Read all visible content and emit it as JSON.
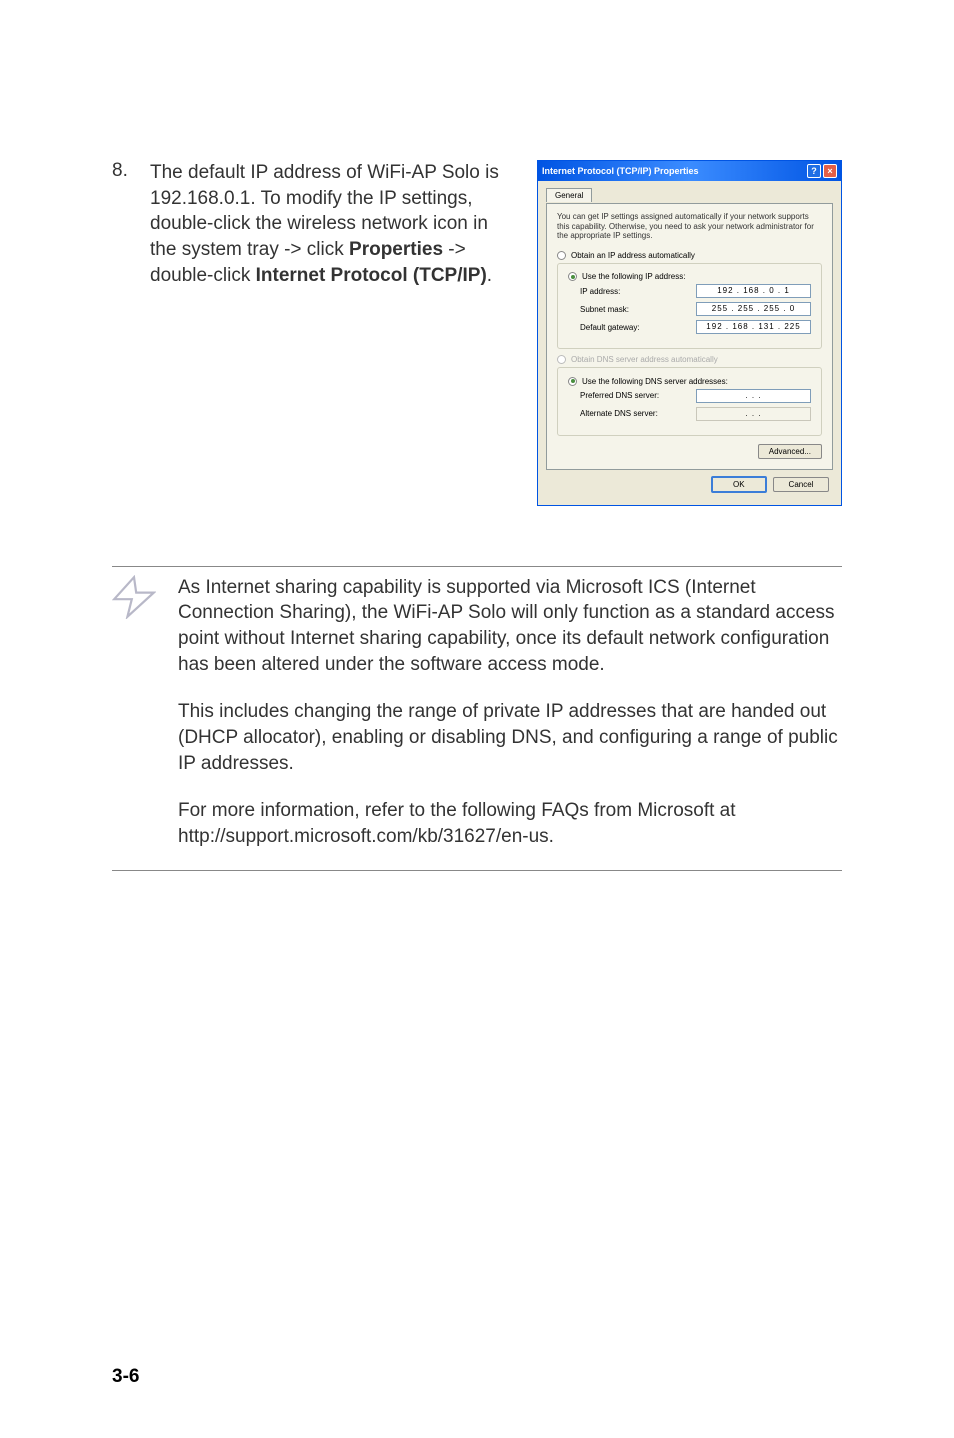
{
  "step": {
    "number": "8.",
    "text_parts": [
      "The default IP address of WiFi-AP Solo is 192.168.0.1. To modify the IP settings, double-click the wireless network icon in the system tray -> click ",
      "Properties",
      " -> double-click ",
      "Internet Protocol (TCP/IP)",
      "."
    ]
  },
  "dialog": {
    "title": "Internet Protocol (TCP/IP) Properties",
    "help_symbol": "?",
    "close_symbol": "×",
    "tab": "General",
    "info": "You can get IP settings assigned automatically if your network supports this capability. Otherwise, you need to ask your network administrator for the appropriate IP settings.",
    "radio_auto_ip": "Obtain an IP address automatically",
    "radio_use_ip": "Use the following IP address:",
    "ip_label": "IP address:",
    "ip_value": "192 . 168 .  0  .  1",
    "subnet_label": "Subnet mask:",
    "subnet_value": "255 . 255 . 255 .  0",
    "gateway_label": "Default gateway:",
    "gateway_value": "192 . 168 . 131 . 225",
    "radio_auto_dns": "Obtain DNS server address automatically",
    "radio_use_dns": "Use the following DNS server addresses:",
    "pref_dns_label": "Preferred DNS server:",
    "pref_dns_value": " .       .       . ",
    "alt_dns_label": "Alternate DNS server:",
    "alt_dns_value": " .       .       . ",
    "advanced": "Advanced...",
    "ok": "OK",
    "cancel": "Cancel"
  },
  "note": {
    "p1": "As Internet sharing capability is supported via Microsoft ICS (Internet Connection Sharing), the WiFi-AP Solo will only function as a standard access point without Internet sharing capability, once its default network configuration has been altered under the software access mode.",
    "p2": "This includes changing the range of private IP addresses that are handed out (DHCP allocator), enabling or disabling DNS, and configuring a range of public IP addresses.",
    "p3": "For more information, refer to the following FAQs from Microsoft at http://support.microsoft.com/kb/31627/en-us."
  },
  "page_num": "3-6"
}
